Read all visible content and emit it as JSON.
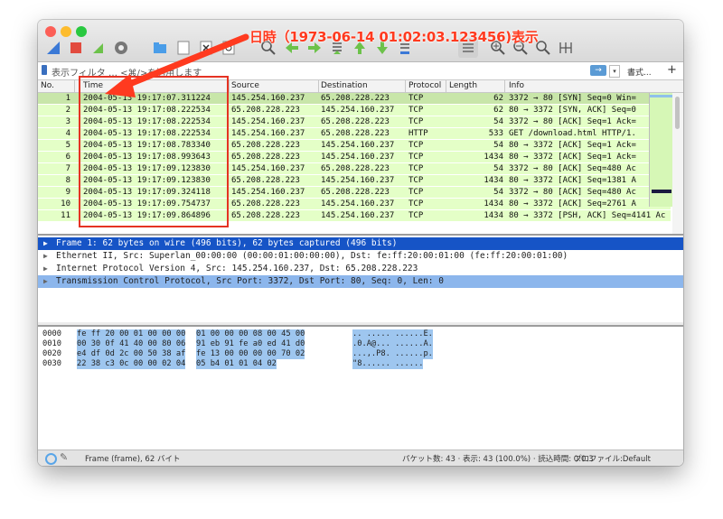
{
  "filter": {
    "placeholder": "表示フィルタ … <⌘/>を適用します",
    "apply_label": "→",
    "expressions_label": "書式...",
    "add_label": "+"
  },
  "toolbar": {
    "icons": [
      "shark-fin-icon",
      "stop-icon",
      "restart-icon",
      "options-gear-icon",
      "open-folder-icon",
      "save-file-icon",
      "close-file-icon",
      "reload-icon",
      "find-icon",
      "back-icon",
      "forward-icon",
      "goto-icon",
      "first-icon",
      "last-icon",
      "autoscroll-icon",
      "colorize-icon",
      "zoom-in-icon",
      "zoom-out-icon",
      "zoom-normal-icon",
      "resize-columns-icon"
    ]
  },
  "columns": [
    "No.",
    "Time",
    "Source",
    "Destination",
    "Protocol",
    "Length",
    "Info"
  ],
  "packets": [
    {
      "no": "1",
      "time": "2004-05-13 19:17:07.311224",
      "src": "145.254.160.237",
      "dst": "65.208.228.223",
      "proto": "TCP",
      "len": "62",
      "info": "3372 → 80 [SYN] Seq=0 Win="
    },
    {
      "no": "2",
      "time": "2004-05-13 19:17:08.222534",
      "src": "65.208.228.223",
      "dst": "145.254.160.237",
      "proto": "TCP",
      "len": "62",
      "info": "80 → 3372 [SYN, ACK] Seq=0"
    },
    {
      "no": "3",
      "time": "2004-05-13 19:17:08.222534",
      "src": "145.254.160.237",
      "dst": "65.208.228.223",
      "proto": "TCP",
      "len": "54",
      "info": "3372 → 80 [ACK] Seq=1 Ack="
    },
    {
      "no": "4",
      "time": "2004-05-13 19:17:08.222534",
      "src": "145.254.160.237",
      "dst": "65.208.228.223",
      "proto": "HTTP",
      "len": "533",
      "info": "GET /download.html HTTP/1."
    },
    {
      "no": "5",
      "time": "2004-05-13 19:17:08.783340",
      "src": "65.208.228.223",
      "dst": "145.254.160.237",
      "proto": "TCP",
      "len": "54",
      "info": "80 → 3372 [ACK] Seq=1 Ack="
    },
    {
      "no": "6",
      "time": "2004-05-13 19:17:08.993643",
      "src": "65.208.228.223",
      "dst": "145.254.160.237",
      "proto": "TCP",
      "len": "1434",
      "info": "80 → 3372 [ACK] Seq=1 Ack="
    },
    {
      "no": "7",
      "time": "2004-05-13 19:17:09.123830",
      "src": "145.254.160.237",
      "dst": "65.208.228.223",
      "proto": "TCP",
      "len": "54",
      "info": "3372 → 80 [ACK] Seq=480 Ac"
    },
    {
      "no": "8",
      "time": "2004-05-13 19:17:09.123830",
      "src": "65.208.228.223",
      "dst": "145.254.160.237",
      "proto": "TCP",
      "len": "1434",
      "info": "80 → 3372 [ACK] Seq=1381 A"
    },
    {
      "no": "9",
      "time": "2004-05-13 19:17:09.324118",
      "src": "145.254.160.237",
      "dst": "65.208.228.223",
      "proto": "TCP",
      "len": "54",
      "info": "3372 → 80 [ACK] Seq=480 Ac"
    },
    {
      "no": "10",
      "time": "2004-05-13 19:17:09.754737",
      "src": "65.208.228.223",
      "dst": "145.254.160.237",
      "proto": "TCP",
      "len": "1434",
      "info": "80 → 3372 [ACK] Seq=2761 A"
    },
    {
      "no": "11",
      "time": "2004-05-13 19:17:09.864896",
      "src": "65.208.228.223",
      "dst": "145.254.160.237",
      "proto": "TCP",
      "len": "1434",
      "info": "80 → 3372 [PSH, ACK] Seq=4141 Ac"
    }
  ],
  "details": [
    {
      "text": "Frame 1: 62 bytes on wire (496 bits), 62 bytes captured (496 bits)",
      "state": "selected"
    },
    {
      "text": "Ethernet II, Src: Superlan_00:00:00 (00:00:01:00:00:00), Dst: fe:ff:20:00:01:00 (fe:ff:20:00:01:00)",
      "state": "normal"
    },
    {
      "text": "Internet Protocol Version 4, Src: 145.254.160.237, Dst: 65.208.228.223",
      "state": "normal"
    },
    {
      "text": "Transmission Control Protocol, Src Port: 3372, Dst Port: 80, Seq: 0, Len: 0",
      "state": "highlighted"
    }
  ],
  "bytes": [
    {
      "offset": "0000",
      "hex1": "fe ff 20 00 01 00 00 00",
      "hex2": "01 00 00 00 08 00 45 00",
      "ascii": ".. ..... ......E."
    },
    {
      "offset": "0010",
      "hex1": "00 30 0f 41 40 00 80 06",
      "hex2": "91 eb 91 fe a0 ed 41 d0",
      "ascii": ".0.A@... ......A."
    },
    {
      "offset": "0020",
      "hex1": "e4 df 0d 2c 00 50 38 af",
      "hex2": "fe 13 00 00 00 00 70 02",
      "ascii": "...,.P8. ......p."
    },
    {
      "offset": "0030",
      "hex1": "22 38 c3 0c 00 00 02 04",
      "hex2": "05 b4 01 01 04 02",
      "ascii": "\"8...... ......"
    }
  ],
  "status": {
    "frame": "Frame (frame), 62 バイト",
    "stats": "パケット数: 43 · 表示: 43 (100.0%) · 読込時間: 0:0.3",
    "profile": "プロファイル:Default"
  },
  "annotation": {
    "text": "日時（1973-06-14 01:02:03.123456)表示",
    "color": "#ff3a1f"
  }
}
